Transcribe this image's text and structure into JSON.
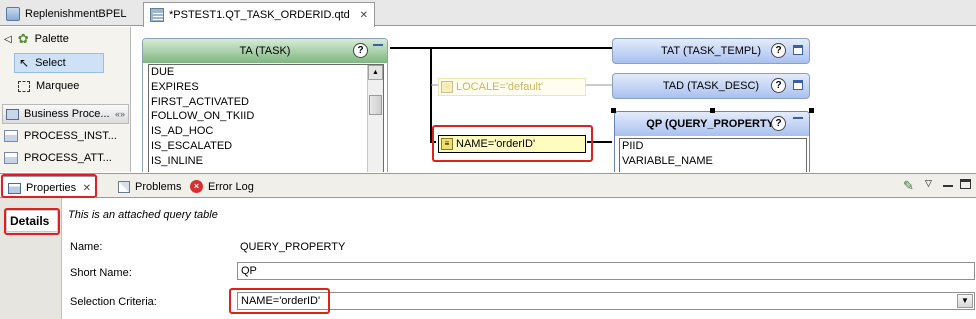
{
  "editor_tabs": [
    {
      "label": "ReplenishmentBPEL",
      "icon": "bpel-file-icon"
    },
    {
      "label": "*PSTEST1.QT_TASK_ORDERID.qtd",
      "icon": "query-table-file-icon",
      "close": "✕"
    }
  ],
  "palette": {
    "header": "Palette",
    "tools": [
      {
        "label": "Select",
        "icon": "arrow-pointer-icon"
      },
      {
        "label": "Marquee",
        "icon": "marquee-icon"
      }
    ],
    "drawer": {
      "label": "Business Proce...",
      "icon": "folder-icon"
    },
    "items": [
      {
        "label": "PROCESS_INST..."
      },
      {
        "label": "PROCESS_ATT..."
      }
    ]
  },
  "canvas": {
    "ta_table": {
      "title": "TA (TASK)",
      "columns": [
        "DUE",
        "EXPIRES",
        "FIRST_ACTIVATED",
        "FOLLOW_ON_TKIID",
        "IS_AD_HOC",
        "IS_ESCALATED",
        "IS_INLINE"
      ]
    },
    "tat_table": {
      "title": "TAT (TASK_TEMPL)"
    },
    "tad_table": {
      "title": "TAD (TASK_DESC)"
    },
    "qp_table": {
      "title": "QP (QUERY_PROPERTY)",
      "columns": [
        "PIID",
        "VARIABLE_NAME"
      ]
    },
    "criterion_locale": "LOCALE='default'",
    "criterion_name": "NAME='orderID'",
    "help_glyph": "?"
  },
  "view_tabs": [
    {
      "label": "Properties",
      "close": "✕"
    },
    {
      "label": "Problems"
    },
    {
      "label": "Error Log"
    }
  ],
  "properties": {
    "section_tab": "Details",
    "description": "This is an attached query table",
    "name_label": "Name:",
    "name_value": "QUERY_PROPERTY",
    "short_name_label": "Short Name:",
    "short_name_value": "QP",
    "selection_label": "Selection Criteria:",
    "selection_value": "NAME='orderID'"
  },
  "colors": {
    "ta_header_green": "#7fb77f",
    "blue_header": "#a8c0f0",
    "highlight_red": "#e02020",
    "criterion_yellow": "#fffcc0"
  }
}
